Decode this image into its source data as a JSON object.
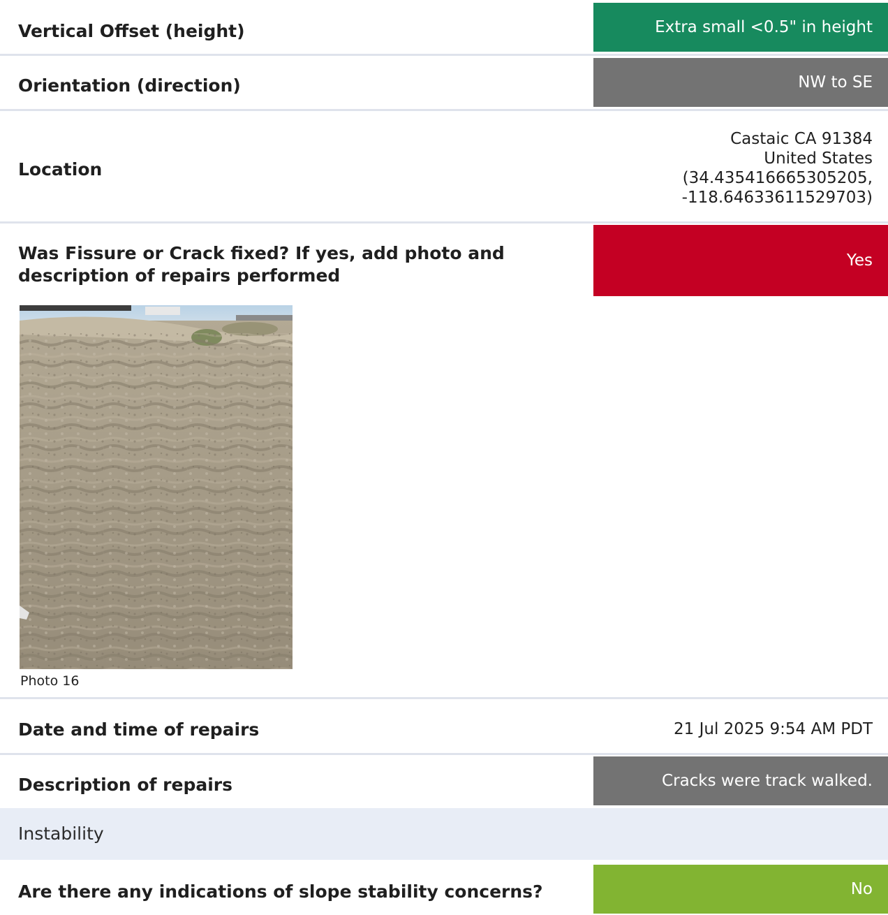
{
  "rows": [
    {
      "label": "Vertical Offset (height)",
      "value": "Extra small <0.5\" in height",
      "color": "#178a5e"
    },
    {
      "label": "Orientation (direction)",
      "value": "NW to SE",
      "color": "#737373"
    },
    {
      "label": "Location",
      "address": [
        "Castaic CA 91384",
        "United States",
        "(34.435416665305205,",
        "-118.64633611529703)"
      ]
    },
    {
      "label": "Was Fissure or Crack fixed? If yes, add photo and description of repairs performed",
      "value": "Yes",
      "color": "#c40023"
    },
    {
      "label": "Date and time of repairs",
      "value": "21 Jul 2025 9:54 AM PDT"
    },
    {
      "label": "Description of repairs",
      "value": "Cracks were track walked.",
      "color": "#737373"
    }
  ],
  "photo": {
    "caption": "Photo 16"
  },
  "section": {
    "title": "Instability"
  },
  "stability": {
    "label": "Are there any indications of slope stability concerns?",
    "value": "No",
    "color": "#82b432"
  }
}
